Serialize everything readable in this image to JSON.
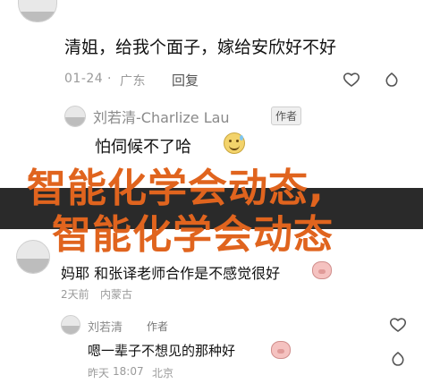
{
  "comments": [
    {
      "text": "清姐，给我个面子，嫁给安欣好不好",
      "date": "01-24",
      "location": "广东",
      "reply_label": "回复"
    }
  ],
  "replies": [
    {
      "name": "刘若清-Charlize Lau",
      "badge": "作者",
      "text": "怕伺候不了哈"
    }
  ],
  "overlay": {
    "line1": "智能化学会动态,",
    "line2": "智能化学会动态"
  },
  "comment2": {
    "text": "妈耶 和张译老师合作是不感觉很好",
    "date": "2天前",
    "location": "内蒙古"
  },
  "reply2": {
    "name": "刘若清",
    "badge": "作者",
    "text": "嗯一辈子不想见的那种好",
    "date": "昨天",
    "time": "18:07",
    "location": "北京"
  },
  "icons": [
    "heart-icon",
    "avatar",
    "pig-emoji",
    "sweat-smile-emoji"
  ],
  "colors": {
    "overlay_text": "#e0641e",
    "overlay_band": "#2a2a2a",
    "meta_gray": "#9a9a9a"
  }
}
